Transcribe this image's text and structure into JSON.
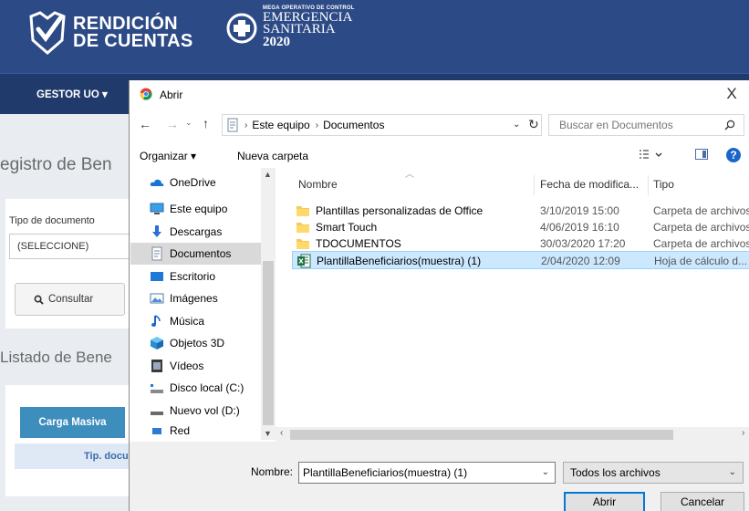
{
  "site": {
    "logo1": {
      "line1": "RENDICIÓN",
      "line2": "DE CUENTAS"
    },
    "logo2": {
      "small": "MEGA OPERATIVO DE CONTROL",
      "line1": "EMERGENCIA",
      "line2": "SANITARIA",
      "year": "2020"
    },
    "nav": {
      "gestor": "GESTOR UO"
    },
    "page_title": "egistro de Ben",
    "form": {
      "tipo_label": "Tipo de documento",
      "tipo_value": "(SELECCIONE)",
      "consultar": "Consultar"
    },
    "list_title": "Listado de Bene",
    "carga_masiva": "Carga Masiva",
    "table_header": "Tip. docu"
  },
  "dialog": {
    "title": "Abrir",
    "close": "X",
    "breadcrumb": [
      "Este equipo",
      "Documentos"
    ],
    "search_placeholder": "Buscar en Documentos",
    "toolbar": {
      "organizar": "Organizar ▾",
      "nueva_carpeta": "Nueva carpeta",
      "help": "?"
    },
    "nav_pane": [
      {
        "label": "OneDrive",
        "icon": "cloud-icon"
      },
      {
        "label": "Este equipo",
        "icon": "computer-icon"
      },
      {
        "label": "Descargas",
        "icon": "download-icon"
      },
      {
        "label": "Documentos",
        "icon": "document-icon",
        "selected": true
      },
      {
        "label": "Escritorio",
        "icon": "desktop-icon"
      },
      {
        "label": "Imágenes",
        "icon": "pictures-icon"
      },
      {
        "label": "Música",
        "icon": "music-icon"
      },
      {
        "label": "Objetos 3D",
        "icon": "cube-icon"
      },
      {
        "label": "Vídeos",
        "icon": "video-icon"
      },
      {
        "label": "Disco local (C:)",
        "icon": "drive-icon"
      },
      {
        "label": "Nuevo vol (D:)",
        "icon": "drive-icon"
      },
      {
        "label": "Red",
        "icon": "network-icon"
      }
    ],
    "columns": {
      "name": "Nombre",
      "date": "Fecha de modifica...",
      "type": "Tipo"
    },
    "files": [
      {
        "name": "Plantillas personalizadas de Office",
        "date": "3/10/2019 15:00",
        "type": "Carpeta de archivos",
        "icon": "folder-icon"
      },
      {
        "name": "Smart Touch",
        "date": "4/06/2019 16:10",
        "type": "Carpeta de archivos",
        "icon": "folder-icon"
      },
      {
        "name": "TDOCUMENTOS",
        "date": "30/03/2020 17:20",
        "type": "Carpeta de archivos",
        "icon": "folder-icon"
      },
      {
        "name": "PlantillaBeneficiarios(muestra) (1)",
        "date": "2/04/2020 12:09",
        "type": "Hoja de cálculo d...",
        "icon": "excel-file-icon",
        "selected": true
      }
    ],
    "footer": {
      "name_label": "Nombre:",
      "name_value": "PlantillaBeneficiarios(muestra) (1)",
      "filter": "Todos los archivos",
      "open": "Abrir",
      "cancel": "Cancelar"
    },
    "colors": {
      "selection": "#cce8ff",
      "accent": "#0078d7",
      "header": "#2c4a86"
    }
  }
}
